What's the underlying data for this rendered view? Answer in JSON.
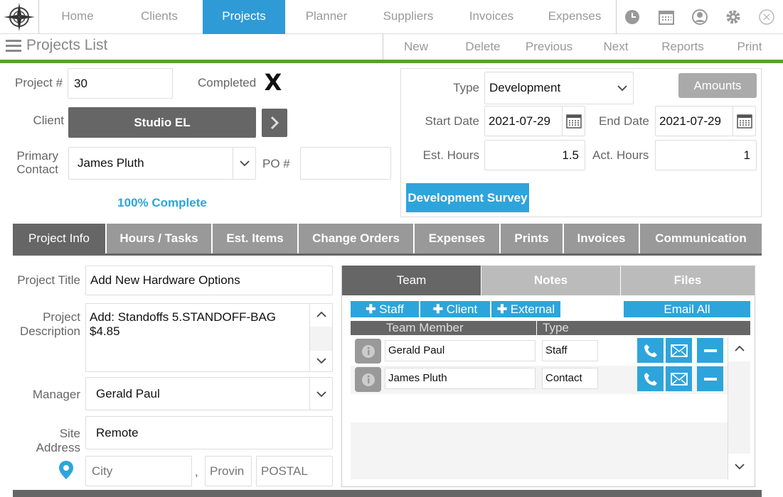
{
  "nav": {
    "tabs": [
      "Home",
      "Clients",
      "Projects",
      "Planner",
      "Suppliers",
      "Invoices",
      "Expenses"
    ],
    "active": "Projects"
  },
  "toolbar": {
    "title": "Projects List",
    "actions": [
      "New",
      "Delete",
      "Previous",
      "Next",
      "Reports",
      "Print"
    ]
  },
  "form": {
    "project_no_label": "Project #",
    "project_no": "30",
    "completed_label": "Completed",
    "completed_mark": "X",
    "client_label": "Client",
    "client": "Studio EL",
    "primary_contact_label_1": "Primary",
    "primary_contact_label_2": "Contact",
    "primary_contact": "James Pluth",
    "po_label": "PO #",
    "po": "",
    "progress_text": "100% Complete",
    "type_label": "Type",
    "type": "Development",
    "amounts_button": "Amounts",
    "start_date_label": "Start Date",
    "start_date": "2021-07-29",
    "end_date_label": "End Date",
    "end_date": "2021-07-29",
    "est_hours_label": "Est. Hours",
    "est_hours": "1.5",
    "act_hours_label": "Act. Hours",
    "act_hours": "1",
    "survey_button": "Development Survey"
  },
  "tabs": {
    "items": [
      "Project Info",
      "Hours / Tasks",
      "Est. Items",
      "Change Orders",
      "Expenses",
      "Prints",
      "Invoices",
      "Communication"
    ],
    "active": "Project Info"
  },
  "info": {
    "title_label": "Project Title",
    "title": "Add New Hardware Options",
    "desc_label_1": "Project",
    "desc_label_2": "Description",
    "desc_line_1": "Add: Standoffs 5.STANDOFF-BAG",
    "desc_line_2": "$4.85",
    "manager_label": "Manager",
    "manager": "Gerald Paul",
    "site_label_1": "Site",
    "site_label_2": "Address",
    "site": "Remote",
    "city_placeholder": "City",
    "comma": ",",
    "province_placeholder": "Provin",
    "postal_placeholder": "POSTAL"
  },
  "team": {
    "subtabs": [
      "Team",
      "Notes",
      "Files"
    ],
    "active": "Team",
    "add_staff": "Staff",
    "add_client": "Client",
    "add_external": "External",
    "email_all": "Email All",
    "col_member": "Team Member",
    "col_type": "Type",
    "rows": [
      {
        "member": "Gerald Paul",
        "type": "Staff"
      },
      {
        "member": "James Pluth",
        "type": "Contact"
      }
    ]
  },
  "colors": {
    "accent": "#2e9bd6",
    "green": "#5aa02c",
    "dark": "#666666"
  }
}
